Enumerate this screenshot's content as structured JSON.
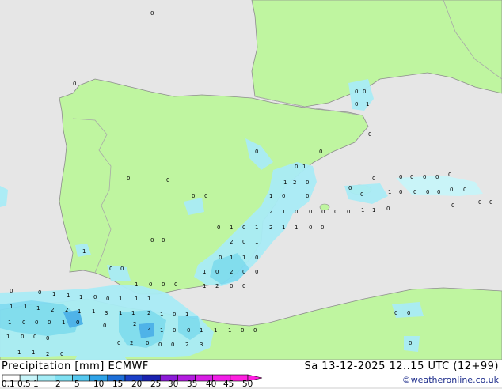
{
  "title": {
    "variable": "Precipitation [mm]",
    "model": "ECMWF"
  },
  "valid_time": "Sa 13-12-2025 12..15 UTC (12+99)",
  "credit": "©weatheronline.co.uk",
  "legend": {
    "labels": [
      "0.1",
      "0.5",
      "1",
      "2",
      "5",
      "10",
      "15",
      "20",
      "25",
      "30",
      "35",
      "40",
      "45",
      "50"
    ],
    "colors": [
      "#ffffff",
      "#c7f4f9",
      "#a4ecf6",
      "#7fe0f2",
      "#55c8ef",
      "#2ea3e8",
      "#1d6fd8",
      "#1b3fc8",
      "#1a22b0",
      "#8c1bd8",
      "#b31ce0",
      "#d81de5",
      "#f21ee8",
      "#ff1fe0"
    ]
  },
  "colors": {
    "sea": "#e6e6e6",
    "land": "#bff5a0",
    "border": "#a8a8a8",
    "coast": "#8c8c8c",
    "precip_light": "#a9ecf6",
    "precip_mid": "#7fdcf2",
    "precip_heavy": "#4ab0ec"
  },
  "grid_values": [
    "0",
    "1",
    "2",
    "3"
  ]
}
